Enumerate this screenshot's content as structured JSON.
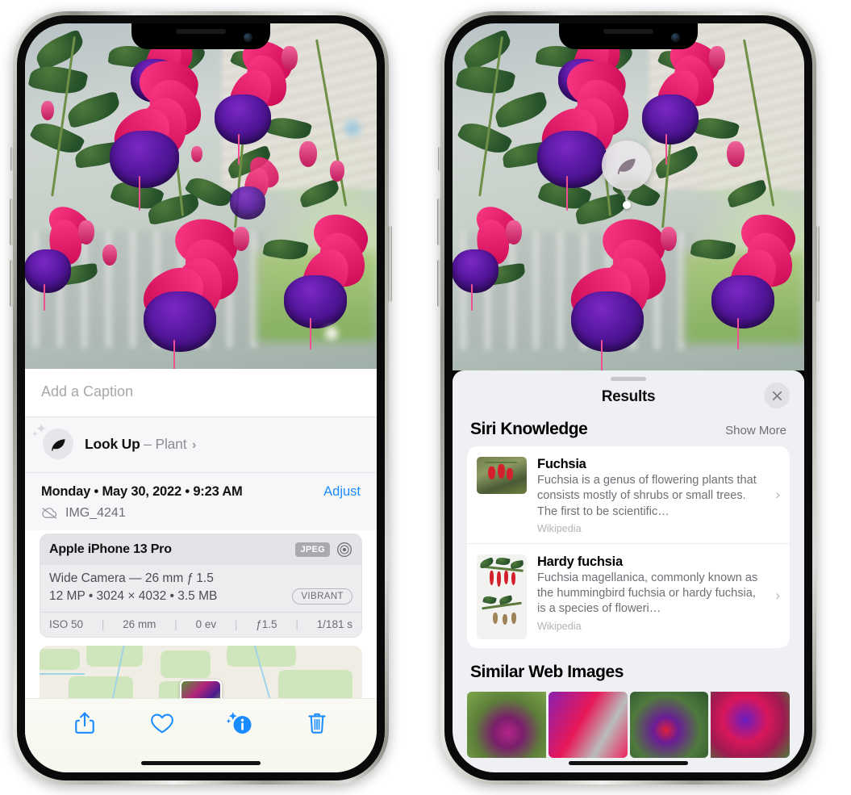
{
  "app": {
    "name": "Photos",
    "platform": "iOS"
  },
  "left_phone": {
    "caption": {
      "placeholder": "Add a Caption",
      "value": ""
    },
    "lookup": {
      "label": "Look Up",
      "dash": "–",
      "subject": "Plant",
      "chevron": "›",
      "icon": "leaf-icon",
      "sparkle": "✦"
    },
    "metadata": {
      "date_line": "Monday • May 30, 2022 • 9:23 AM",
      "adjust_label": "Adjust",
      "filename": "IMG_4241",
      "cloud_icon": "cloud-slash-icon"
    },
    "exif": {
      "device": "Apple iPhone 13 Pro",
      "format_tag": "JPEG",
      "raw_icon": "aperture-icon",
      "lens_line": "Wide Camera — 26 mm ƒ 1.5",
      "size_line": "12 MP • 3024 × 4032 • 3.5 MB",
      "style_tag": "VIBRANT",
      "stats": [
        "ISO 50",
        "26 mm",
        "0 ev",
        "ƒ1.5",
        "1/181 s"
      ],
      "separator": "|"
    },
    "toolbar": [
      {
        "name": "share-button",
        "icon": "share-icon",
        "color": "#1a8cff"
      },
      {
        "name": "favorite-button",
        "icon": "heart-icon",
        "color": "#1a8cff"
      },
      {
        "name": "info-button",
        "icon": "info-sparkle-icon",
        "color": "#1a8cff"
      },
      {
        "name": "delete-button",
        "icon": "trash-icon",
        "color": "#1a8cff"
      }
    ]
  },
  "right_phone": {
    "marker": {
      "icon": "leaf-icon",
      "label": "Visual Look Up marker"
    },
    "sheet": {
      "title": "Results",
      "close_icon": "close-icon",
      "grabber": "drag-handle"
    },
    "siri_knowledge": {
      "section_title": "Siri Knowledge",
      "show_more": "Show More",
      "items": [
        {
          "title": "Fuchsia",
          "description": "Fuchsia is a genus of flowering plants that consists mostly of shrubs or small trees. The first to be scientific…",
          "source": "Wikipedia",
          "chevron": "›"
        },
        {
          "title": "Hardy fuchsia",
          "description": "Fuchsia magellanica, commonly known as the hummingbird fuchsia or hardy fuchsia, is a species of floweri…",
          "source": "Wikipedia",
          "chevron": "›"
        }
      ]
    },
    "similar_web_images": {
      "section_title": "Similar Web Images",
      "count": 4
    }
  },
  "colors": {
    "accent_blue": "#1a8cff",
    "sheet_bg": "#eff0f4",
    "card_bg": "#ffffff",
    "secondary_text": "#6e6e73",
    "tertiary_text": "#b2b2b8",
    "exif_bg": "#ededf0"
  }
}
